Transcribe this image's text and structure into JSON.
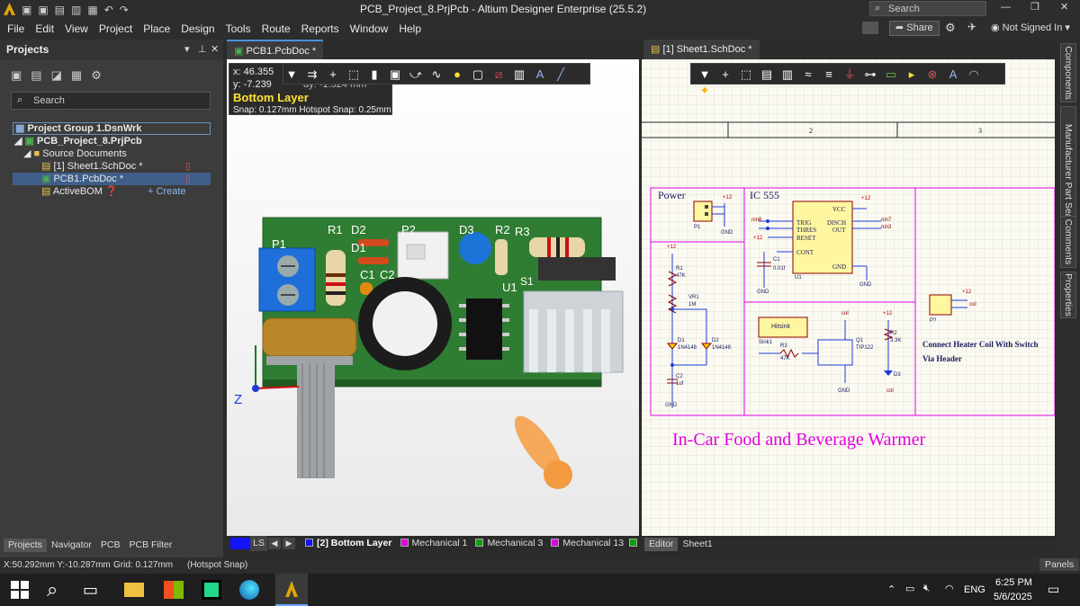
{
  "titlebar": {
    "title": "PCB_Project_8.PrjPcb - Altium Designer Enterprise (25.5.2)",
    "search_placeholder": "Search"
  },
  "menu": [
    "File",
    "Edit",
    "View",
    "Project",
    "Place",
    "Design",
    "Tools",
    "Route",
    "Reports",
    "Window",
    "Help"
  ],
  "toolbar_right": {
    "share": "Share",
    "user": "Not Signed In"
  },
  "projects_panel": {
    "title": "Projects",
    "search_placeholder": "Search",
    "group": "Project Group 1.DsnWrk",
    "project": "PCB_Project_8.PrjPcb",
    "folder": "Source Documents",
    "files": [
      "[1] Sheet1.SchDoc *",
      "PCB1.PcbDoc *",
      "ActiveBOM"
    ],
    "create_label": "+ Create",
    "bottom_tabs": [
      "Projects",
      "Navigator",
      "PCB",
      "PCB Filter"
    ]
  },
  "pcb_tab": "PCB1.PcbDoc *",
  "sch_tab": "[1] Sheet1.SchDoc *",
  "hud": {
    "x": "x: 46.355",
    "y": "y: -7.239",
    "dy": "dy: -1.524 mm",
    "layer": "Bottom Layer",
    "snap": "Snap: 0.127mm Hotspot Snap: 0.25mm"
  },
  "board_labels": {
    "p1": "P1",
    "r1": "R1",
    "d2": "D2",
    "d1": "D1",
    "p2": "P2",
    "d3": "D3",
    "r2": "R2",
    "r3": "R3",
    "c1": "C1",
    "c2": "C2",
    "u1": "U1",
    "s": "S1",
    "axis": "Z"
  },
  "layers": {
    "ls": "LS",
    "items": [
      {
        "name": "[2] Bottom Layer",
        "color": "#1414ff"
      },
      {
        "name": "Mechanical 1",
        "color": "#e000e0"
      },
      {
        "name": "Mechanical 3",
        "color": "#10a010"
      },
      {
        "name": "Mechanical 13",
        "color": "#e000e0"
      }
    ]
  },
  "sch_bottom_tabs": [
    "Editor",
    "Sheet1"
  ],
  "schematic": {
    "zone2": "2",
    "zone3": "3",
    "power_title": "Power",
    "ic_title": "IC 555",
    "big_title": "In-Car Food and Beverage Warmer",
    "note_line1": "Connect Heater Coil With Switch",
    "note_line2": "Via Header",
    "ic_pins_left": [
      "TRIG",
      "THRES",
      "RESET",
      "CONT"
    ],
    "ic_pins_right": [
      "VCC",
      "DISCH",
      "OUT",
      "GND"
    ],
    "labels": {
      "p1": "P1",
      "gnd": "GND",
      "plus12": "+12",
      "u1": "U1",
      "c1": "C1",
      "c1v": "0.01f",
      "r1": "R1",
      "r1v": "47K",
      "vr1": "VR1",
      "vr1v": "1M",
      "d1": "D1",
      "d1v": "1N4148",
      "d2": "D2",
      "d2v": "1N4148",
      "c2": "C2",
      "c2v": "1uf",
      "heatsink": "Hitsink",
      "sink": "Sink1",
      "r3": "R3",
      "r3v": "47K",
      "q1": "Q1",
      "q1v": "TIP122",
      "r2": "R2",
      "r2v": "3.3K",
      "d3": "D3",
      "p2": "P?",
      "nin6": "nin6",
      "nin7": "nin7",
      "nin3": "nin3",
      "col": "col"
    }
  },
  "rightbar": [
    "Components",
    "Manufacturer Part Search",
    "Comments",
    "Properties"
  ],
  "status": {
    "coords": "X:50.292mm Y:-10.287mm",
    "grid": "Grid: 0.127mm",
    "snap": "(Hotspot Snap)",
    "panels": "Panels"
  },
  "taskbar": {
    "lang": "ENG",
    "time": "6:25 PM",
    "date": "5/6/2025"
  },
  "colors": {
    "pcb_green": "#2f7d32",
    "magenta": "#e000e0",
    "accent_blue": "#1f6bd6",
    "panel_bg": "#3c3c3c"
  }
}
